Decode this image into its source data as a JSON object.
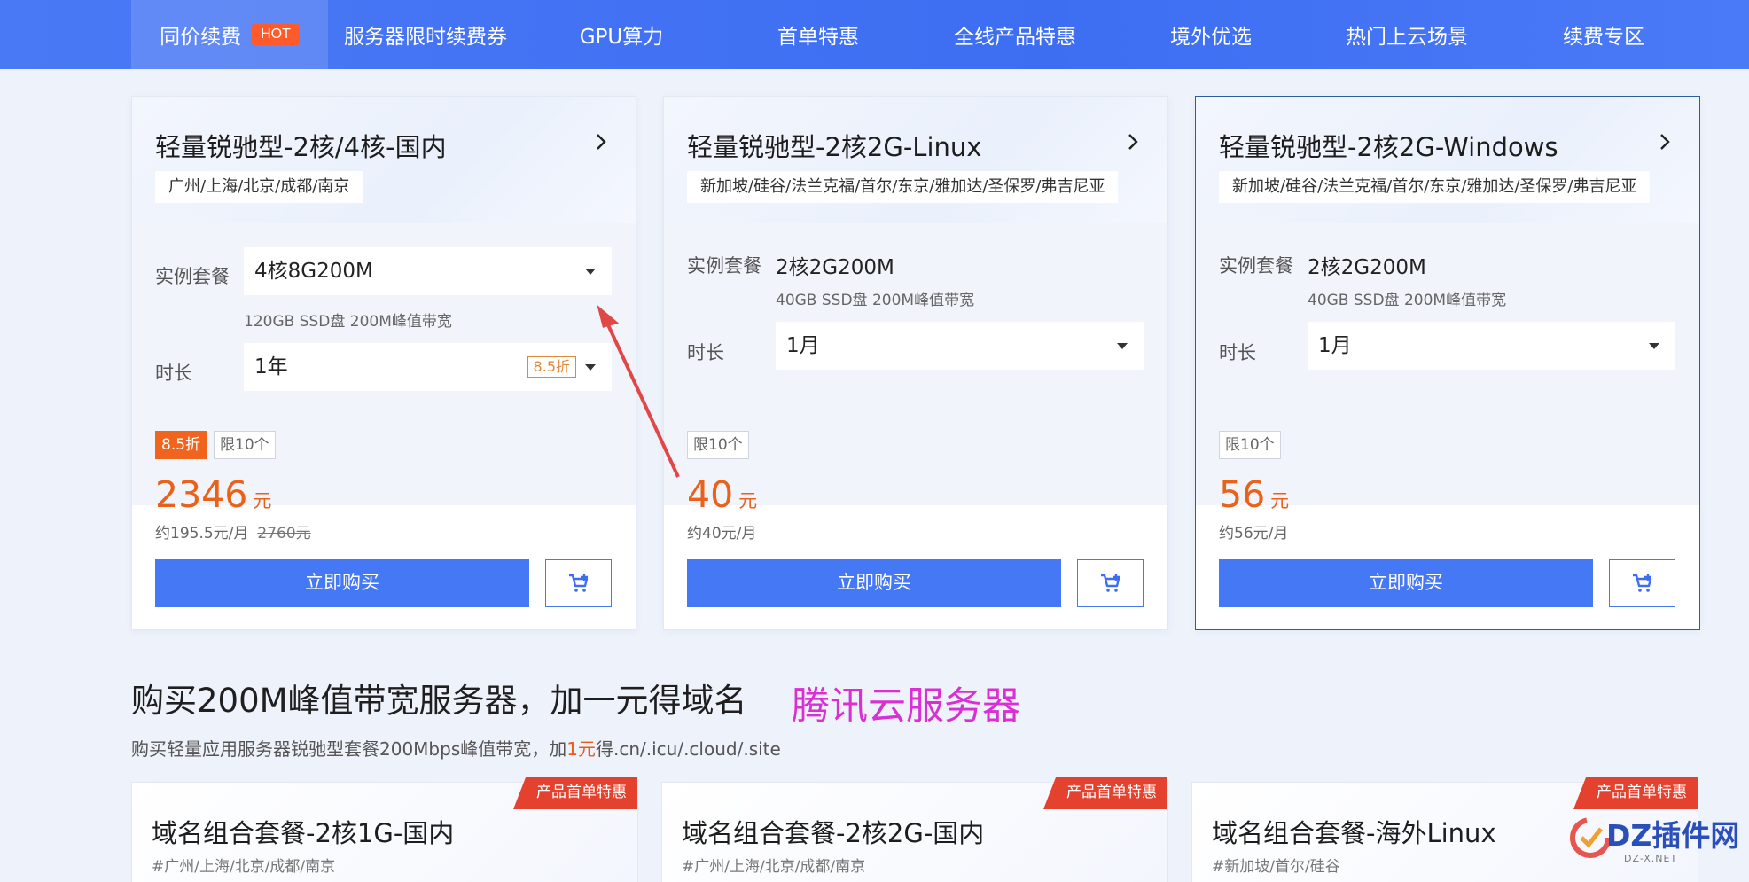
{
  "nav": {
    "items": [
      {
        "label": "同价续费",
        "badge": "HOT"
      },
      {
        "label": "服务器限时续费券"
      },
      {
        "label": "GPU算力"
      },
      {
        "label": "首单特惠"
      },
      {
        "label": "全线产品特惠"
      },
      {
        "label": "境外优选"
      },
      {
        "label": "热门上云场景"
      },
      {
        "label": "续费专区"
      }
    ]
  },
  "cards": [
    {
      "title": "轻量锐驰型-2核/4核-国内",
      "region": "广州/上海/北京/成都/南京",
      "plan_label": "实例套餐",
      "plan_value": "4核8G200M",
      "spec": "120GB SSD盘 200M峰值带宽",
      "duration_label": "时长",
      "duration_value": "1年",
      "duration_discount": "8.5折",
      "discount_tag": "8.5折",
      "limit_tag": "限10个",
      "price": "2346",
      "price_unit": "元",
      "monthly": "约195.5元/月",
      "original_price": "2760元",
      "buy_label": "立即购买"
    },
    {
      "title": "轻量锐驰型-2核2G-Linux",
      "region": "新加坡/硅谷/法兰克福/首尔/东京/雅加达/圣保罗/弗吉尼亚",
      "plan_label": "实例套餐",
      "plan_value": "2核2G200M",
      "spec": "40GB SSD盘 200M峰值带宽",
      "duration_label": "时长",
      "duration_value": "1月",
      "limit_tag": "限10个",
      "price": "40",
      "price_unit": "元",
      "monthly": "约40元/月",
      "buy_label": "立即购买"
    },
    {
      "title": "轻量锐驰型-2核2G-Windows",
      "region": "新加坡/硅谷/法兰克福/首尔/东京/雅加达/圣保罗/弗吉尼亚",
      "plan_label": "实例套餐",
      "plan_value": "2核2G200M",
      "spec": "40GB SSD盘 200M峰值带宽",
      "duration_label": "时长",
      "duration_value": "1月",
      "limit_tag": "限10个",
      "price": "56",
      "price_unit": "元",
      "monthly": "约56元/月",
      "buy_label": "立即购买"
    }
  ],
  "section": {
    "title": "购买200M峰值带宽服务器，加一元得域名",
    "brand_annotation": "腾讯云服务器",
    "subtitle_pre": "购买轻量应用服务器锐驰型套餐200Mbps峰值带宽，加",
    "subtitle_highlight": "1元",
    "subtitle_post": "得.cn/.icu/.cloud/.site"
  },
  "bottom_cards": [
    {
      "title": "域名组合套餐-2核1G-国内",
      "region": "#广州/上海/北京/成都/南京",
      "ribbon": "产品首单特惠"
    },
    {
      "title": "域名组合套餐-2核2G-国内",
      "region": "#广州/上海/北京/成都/南京",
      "ribbon": "产品首单特惠"
    },
    {
      "title": "域名组合套餐-海外Linux",
      "region": "#新加坡/首尔/硅谷",
      "ribbon": "产品首单特惠"
    }
  ],
  "watermark": {
    "text": "DZ插件网",
    "sub": "DZ-X.NET"
  },
  "colors": {
    "nav": "#4576f4",
    "accent": "#4578f4",
    "price": "#ea6119",
    "ribbon": "#e4422f",
    "annotation": "#d92fd3"
  }
}
